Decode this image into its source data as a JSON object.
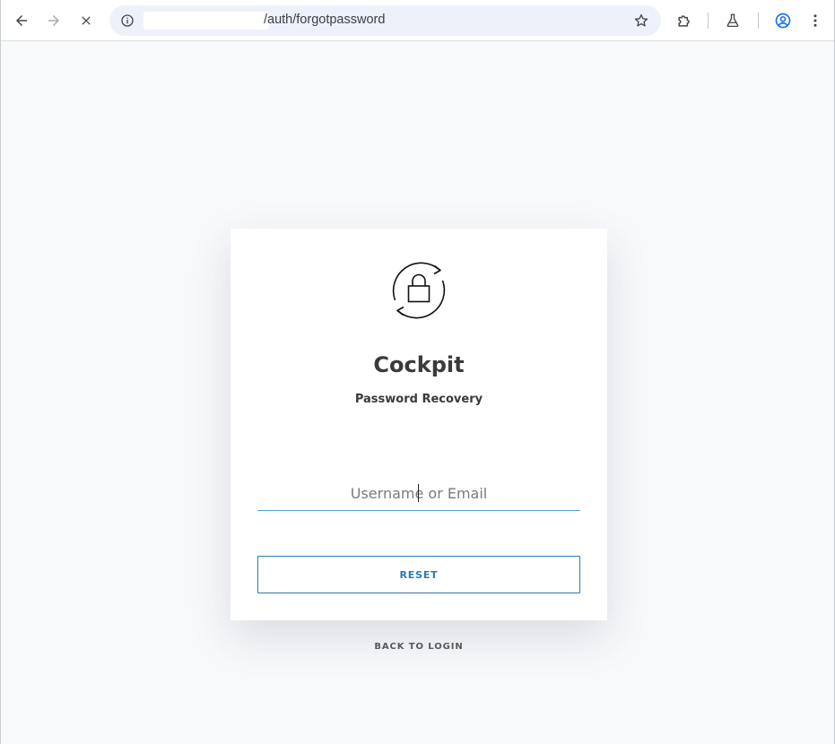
{
  "browser": {
    "url_visible": "/auth/forgotpassword",
    "icons": {
      "back": "arrow-left-icon",
      "forward": "arrow-right-icon",
      "stop": "close-icon",
      "site_info": "info-icon",
      "bookmark": "star-icon",
      "extensions": "puzzle-icon",
      "labs": "flask-icon",
      "profile": "account-circle-icon",
      "menu": "more-vert-icon"
    },
    "accent": "#1a73e8"
  },
  "card": {
    "logo_icon": "lock-refresh-icon",
    "title": "Cockpit",
    "subtitle": "Password Recovery",
    "input": {
      "placeholder": "Username or Email",
      "value": ""
    },
    "reset_label": "RESET"
  },
  "footer": {
    "back_to_login_label": "BACK TO LOGIN"
  },
  "colors": {
    "page_background": "#f8f9fb",
    "card_background": "#ffffff",
    "primary": "#2c7ab3",
    "input_underline": "#5aa6d6",
    "text": "#3a3a3a"
  }
}
